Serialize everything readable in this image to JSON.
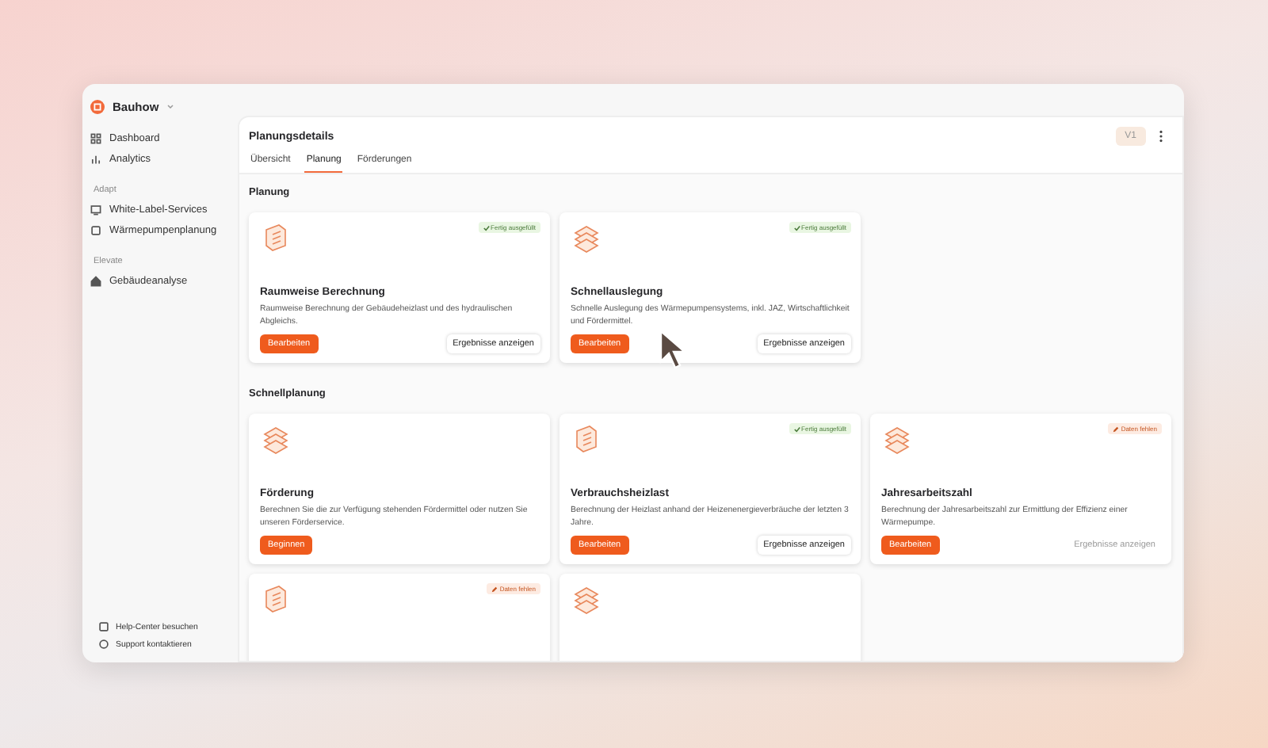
{
  "workspace": {
    "name": "Bauhow"
  },
  "sidebar": {
    "items": [
      {
        "label": "Dashboard"
      },
      {
        "label": "Analytics"
      }
    ],
    "groups": [
      {
        "title": "Adapt",
        "items": [
          {
            "label": "White-Label-Services"
          },
          {
            "label": "Wärmepumpenplanung"
          }
        ]
      },
      {
        "title": "Elevate",
        "items": [
          {
            "label": "Gebäudeanalyse"
          }
        ]
      }
    ],
    "footer": [
      {
        "label": "Help-Center besuchen"
      },
      {
        "label": "Support kontaktieren"
      }
    ]
  },
  "header": {
    "title": "Planungsdetails",
    "version": "V1"
  },
  "tabs": [
    {
      "label": "Übersicht",
      "selected": false
    },
    {
      "label": "Planung",
      "selected": true
    },
    {
      "label": "Förderungen",
      "selected": false
    }
  ],
  "sections": [
    {
      "title": "Planung",
      "cards": [
        {
          "kind": "full",
          "title": "Raumweise Berechnung",
          "description": "Raumweise Berechnung der Gebäudeheizlast und des hydraulischen Abgleichs.",
          "status": {
            "kind": "done",
            "label": "Fertig ausgefüllt"
          },
          "start_button": "Bearbeiten",
          "results_button": {
            "label": "Ergebnisse anzeigen",
            "disabled": false
          }
        },
        {
          "kind": "full",
          "title": "Schnellauslegung",
          "description": "Schnelle Auslegung des Wärmepumpensystems, inkl. JAZ, Wirtschaftlichkeit und Fördermittel.",
          "status": {
            "kind": "done",
            "label": "Fertig ausgefüllt"
          },
          "start_button": "Bearbeiten",
          "results_button": {
            "label": "Ergebnisse anzeigen",
            "disabled": false
          }
        }
      ]
    },
    {
      "title": "Schnellplanung",
      "cards": [
        {
          "kind": "full",
          "title": "Förderung",
          "description": "Berechnen Sie die zur Verfügung stehenden Fördermittel oder nutzen Sie unseren Förderservice.",
          "start_button": "Beginnen"
        },
        {
          "kind": "full",
          "title": "Verbrauchsheizlast",
          "description": "Berechnung der Heizlast anhand der Heizenenergieverbräuche der letzten 3 Jahre.",
          "status": {
            "kind": "done",
            "label": "Fertig ausgefüllt"
          },
          "start_button": "Bearbeiten",
          "results_button": {
            "label": "Ergebnisse anzeigen",
            "disabled": false
          }
        },
        {
          "kind": "full",
          "title": "Jahresarbeitszahl",
          "description": "Berechnung der Jahresarbeitszahl zur Ermittlung der Effizienz einer Wärmepumpe.",
          "status": {
            "kind": "missing",
            "label": "Daten fehlen"
          },
          "start_button": "Bearbeiten",
          "results_button": {
            "label": "Ergebnisse anzeigen",
            "disabled": true
          }
        },
        {
          "kind": "cut",
          "status": {
            "kind": "missing",
            "label": "Daten fehlen"
          }
        },
        {
          "kind": "cut"
        }
      ]
    }
  ]
}
